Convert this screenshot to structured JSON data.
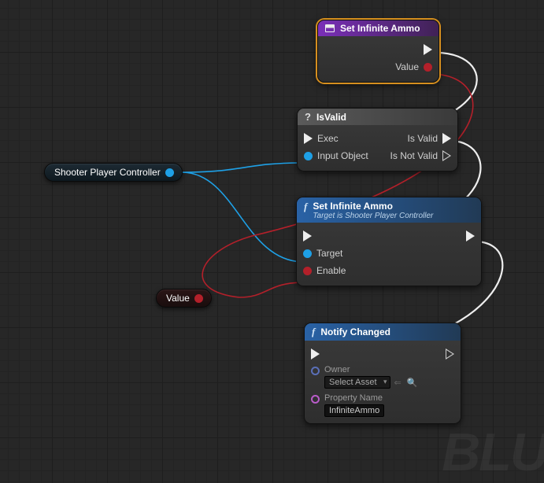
{
  "watermark": "BLU",
  "pills": {
    "spc": {
      "label": "Shooter Player Controller"
    },
    "value": {
      "label": "Value"
    }
  },
  "nodes": {
    "setInfiniteAmmoEvent": {
      "title": "Set Infinite Ammo",
      "pins": {
        "value": "Value"
      }
    },
    "isValid": {
      "title": "IsValid",
      "pins": {
        "exec": "Exec",
        "inputObject": "Input Object",
        "isValid": "Is Valid",
        "isNotValid": "Is Not Valid"
      }
    },
    "setInfiniteAmmoFn": {
      "title": "Set Infinite Ammo",
      "subtitle": "Target is Shooter Player Controller",
      "pins": {
        "target": "Target",
        "enable": "Enable"
      }
    },
    "notifyChanged": {
      "title": "Notify Changed",
      "pins": {
        "owner": "Owner",
        "ownerDefault": "Select Asset",
        "propName": "Property Name",
        "propValue": "InfiniteAmmo"
      }
    }
  }
}
